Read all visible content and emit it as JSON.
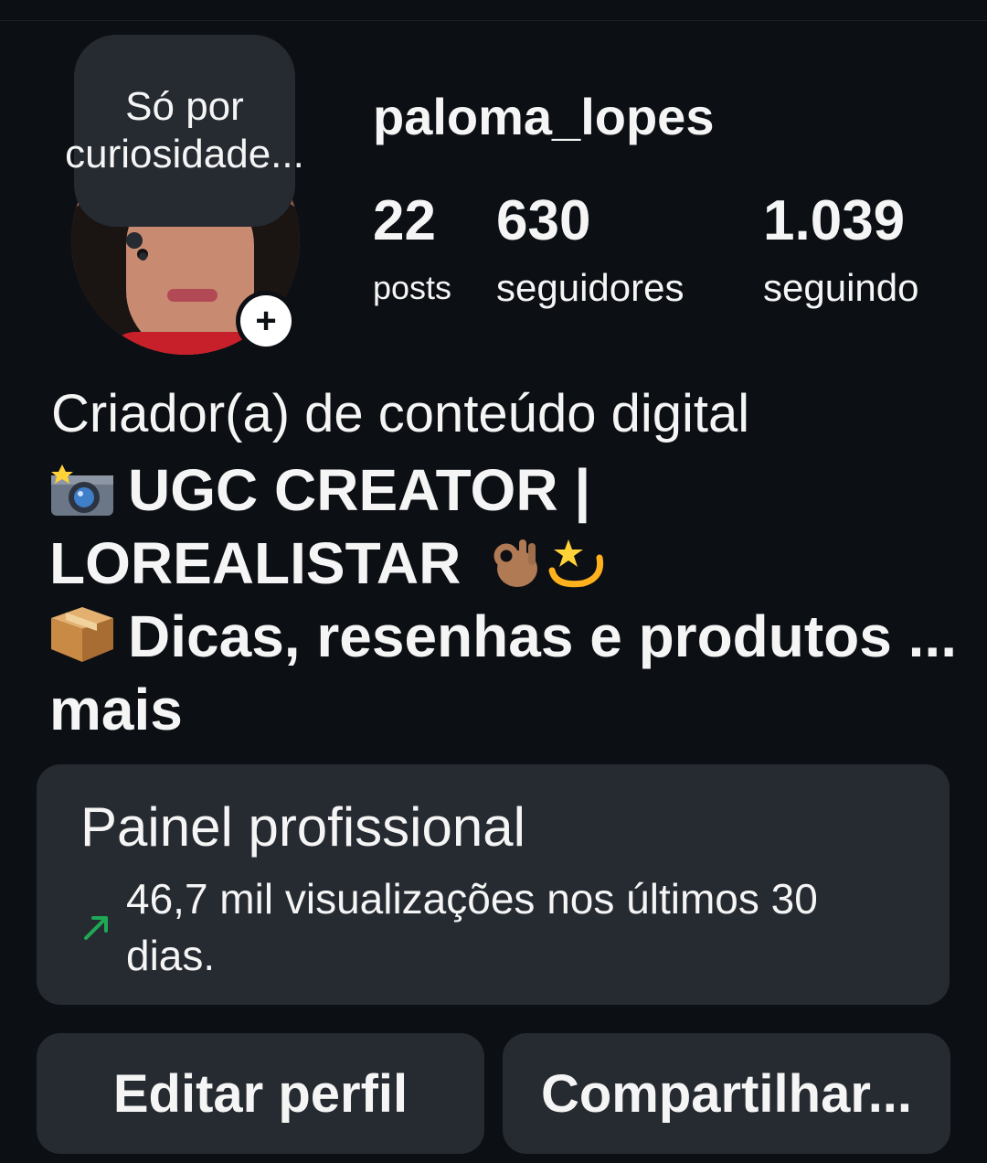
{
  "profile": {
    "note": "Só por curiosidade...",
    "username": "paloma_lopes"
  },
  "stats": {
    "posts": {
      "value": "22",
      "label": "posts"
    },
    "followers": {
      "value": "630",
      "label": "seguidores"
    },
    "following": {
      "value": "1.039",
      "label": "seguindo"
    }
  },
  "bio": {
    "category": "Criador(a) de conteúdo digital",
    "line1": "UGC CREATOR |",
    "line2": "LOREALISTAR",
    "line3": "Dicas, resenhas e produtos ...",
    "more": "mais",
    "icons": [
      "camera-with-flash-emoji",
      "ok-hand-emoji",
      "dizzy-emoji",
      "package-emoji"
    ]
  },
  "dashboard": {
    "title": "Painel profissional",
    "subtitle": "46,7 mil visualizações nos últimos 30 dias.",
    "trend_color": "#1fa855"
  },
  "actions": {
    "edit": "Editar perfil",
    "share": "Compartilhar..."
  },
  "colors": {
    "background": "#0c0f14",
    "card": "#262a31",
    "text": "#f5f5f5"
  }
}
